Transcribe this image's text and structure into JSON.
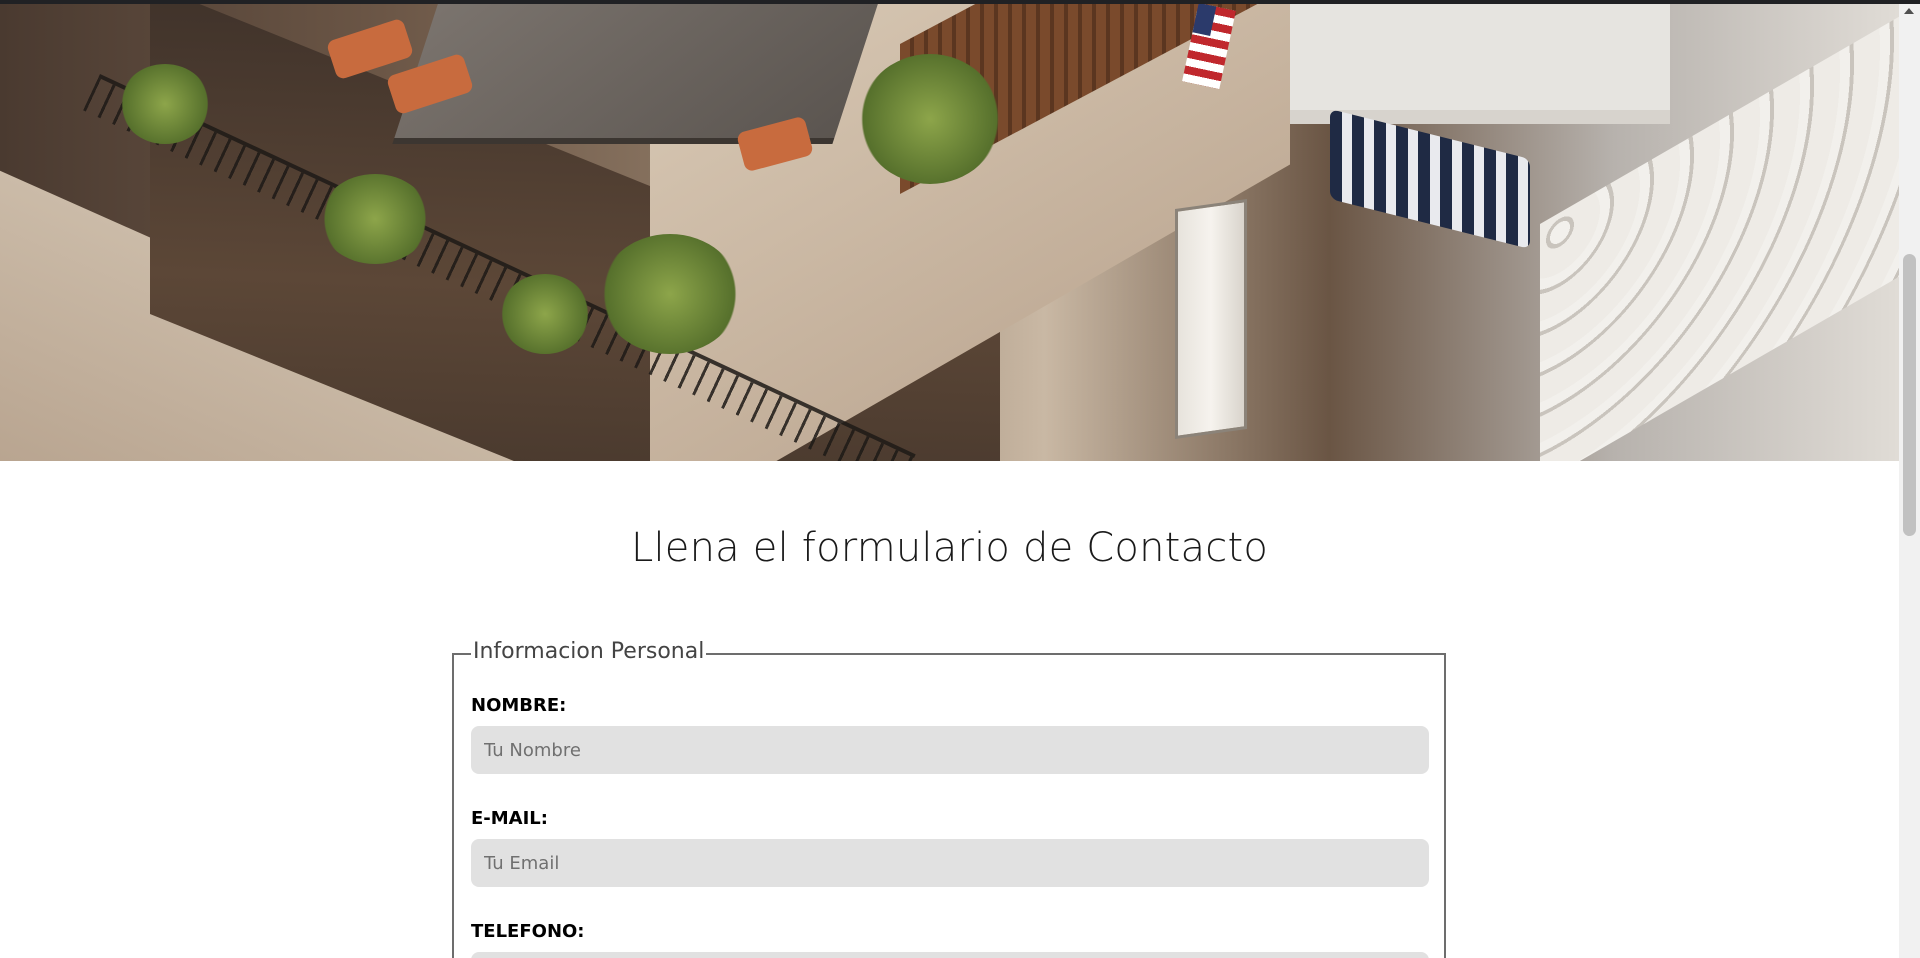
{
  "hero": {
    "image": "rooftop-terrace-photo"
  },
  "contact": {
    "title": "Llena el formulario de Contacto",
    "fieldset_legend": "Informacion Personal",
    "fields": [
      {
        "label": "NOMBRE:",
        "placeholder": "Tu Nombre",
        "value": ""
      },
      {
        "label": "E-MAIL:",
        "placeholder": "Tu Email",
        "value": ""
      },
      {
        "label": "TELEFONO:",
        "placeholder": "",
        "value": ""
      }
    ]
  },
  "colors": {
    "input_background": "#e1e1e1",
    "fieldset_border": "#6d6d6d",
    "title_text": "#1a1a1a"
  }
}
